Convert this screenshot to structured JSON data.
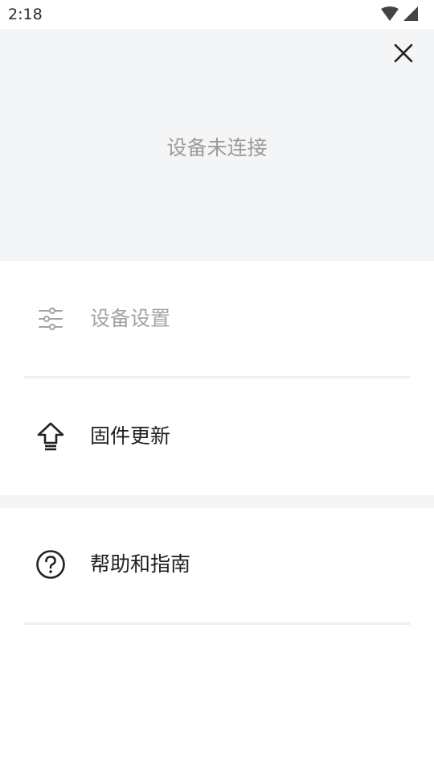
{
  "status_bar": {
    "time": "2:18",
    "icons": [
      "wifi-icon",
      "cellular-signal-icon"
    ]
  },
  "header": {
    "close_icon": "close-icon",
    "device_status": "设备未连接"
  },
  "menu": {
    "device_settings": {
      "label": "设备设置",
      "icon": "sliders-icon",
      "enabled": false
    },
    "firmware_update": {
      "label": "固件更新",
      "icon": "upload-arrow-icon",
      "enabled": true
    },
    "help_guide": {
      "label": "帮助和指南",
      "icon": "help-circle-icon",
      "enabled": true
    }
  },
  "colors": {
    "header_bg": "#f4f5f7",
    "text_primary": "#1f1f1f",
    "text_disabled": "#a3a3a3",
    "divider": "#eeeeee"
  }
}
